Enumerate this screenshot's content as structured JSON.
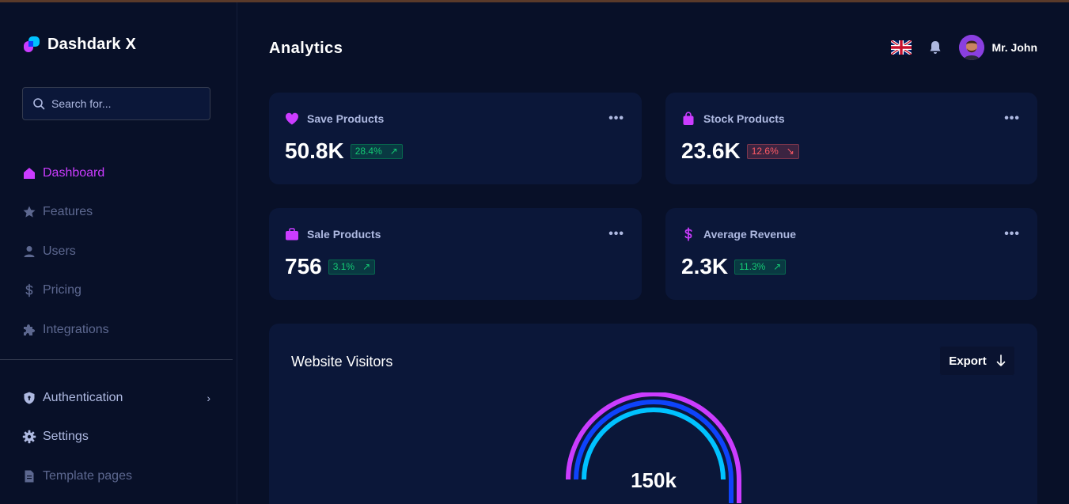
{
  "brand": {
    "name": "Dashdark X"
  },
  "search": {
    "placeholder": "Search for..."
  },
  "nav": {
    "primary": [
      {
        "label": "Dashboard",
        "icon": "home-icon",
        "active": true
      },
      {
        "label": "Features",
        "icon": "star-icon"
      },
      {
        "label": "Users",
        "icon": "user-icon"
      },
      {
        "label": "Pricing",
        "icon": "dollar-icon"
      },
      {
        "label": "Integrations",
        "icon": "puzzle-icon"
      }
    ],
    "secondary": [
      {
        "label": "Authentication",
        "icon": "shield-icon",
        "chevron": "›"
      },
      {
        "label": "Settings",
        "icon": "gear-icon"
      },
      {
        "label": "Template pages",
        "icon": "file-icon"
      }
    ]
  },
  "header": {
    "title": "Analytics",
    "user_name": "Mr. John"
  },
  "stats": [
    {
      "title": "Save Products",
      "icon": "heart-icon",
      "value": "50.8K",
      "change": "28.4%",
      "direction": "up",
      "arrow": "↗"
    },
    {
      "title": "Stock Products",
      "icon": "bag-icon",
      "value": "23.6K",
      "change": "12.6%",
      "direction": "down",
      "arrow": "↘"
    },
    {
      "title": "Sale Products",
      "icon": "briefcase-icon",
      "value": "756",
      "change": "3.1%",
      "direction": "up",
      "arrow": "↗"
    },
    {
      "title": "Average Revenue",
      "icon": "dollar-icon",
      "value": "2.3K",
      "change": "11.3%",
      "direction": "up",
      "arrow": "↗"
    }
  ],
  "more_menu": "•••",
  "visitors": {
    "title": "Website Visitors",
    "export_label": "Export",
    "export_icon": "arrow-down-icon",
    "total": "150k"
  },
  "colors": {
    "background": "#081028",
    "card": "#0b1739",
    "accent": "#cb3cff",
    "muted": "#5d6890",
    "text_secondary": "#aeb9e1",
    "up": "#14ca74",
    "down": "#ff5a65",
    "gauge_purple": "#cb3cff",
    "gauge_blue": "#0e43fb",
    "gauge_cyan": "#00c2ff"
  }
}
